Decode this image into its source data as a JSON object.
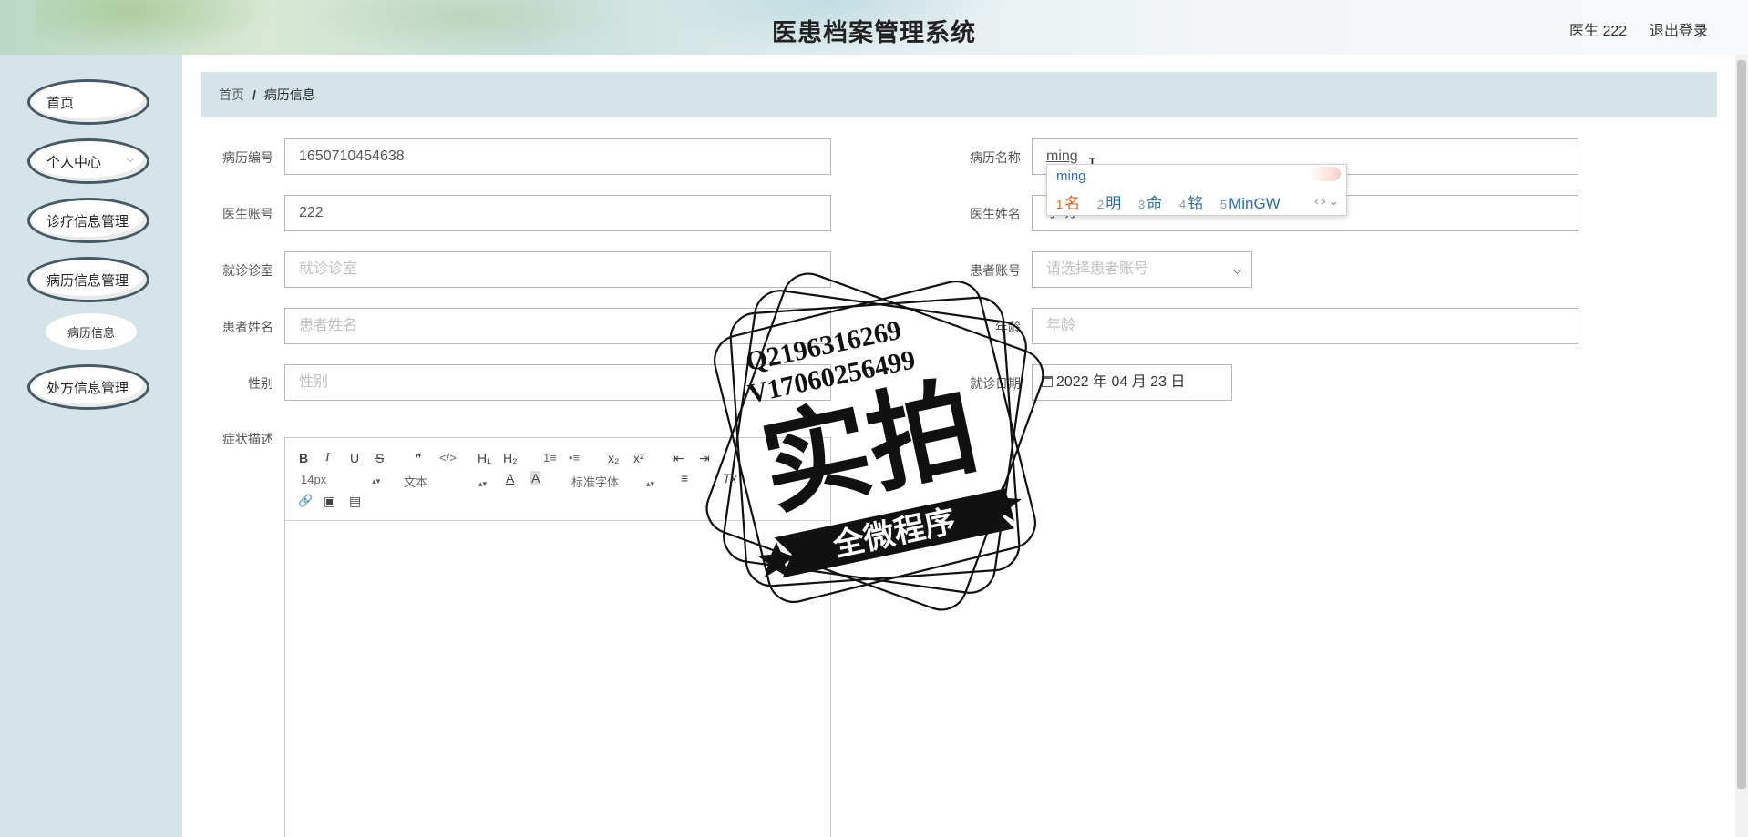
{
  "header": {
    "app_title": "医患档案管理系统",
    "user_label": "医生 222",
    "logout": "退出登录"
  },
  "sidebar": {
    "items": [
      {
        "label": "首页"
      },
      {
        "label": "个人中心",
        "chevron": "⌵"
      },
      {
        "label": "诊疗信息管理"
      },
      {
        "label": "病历信息管理"
      },
      {
        "label": "处方信息管理"
      }
    ],
    "sub_item": "病历信息"
  },
  "breadcrumb": {
    "home": "首页",
    "separator": "/",
    "current": "病历信息"
  },
  "form": {
    "record_no": {
      "label": "病历编号",
      "value": "1650710454638"
    },
    "doctor_account": {
      "label": "医生账号",
      "value": "222"
    },
    "clinic_room": {
      "label": "就诊诊室",
      "placeholder": "就诊诊室"
    },
    "patient_name": {
      "label": "患者姓名",
      "placeholder": "患者姓名"
    },
    "gender": {
      "label": "性别",
      "placeholder": "性别"
    },
    "symptom": {
      "label": "症状描述"
    },
    "record_name": {
      "label": "病历名称",
      "value": "ming"
    },
    "doctor_name": {
      "label": "医生姓名",
      "value": "小明"
    },
    "patient_account": {
      "label": "患者账号",
      "placeholder": "请选择患者账号"
    },
    "age": {
      "label": "年龄",
      "placeholder": "年龄"
    },
    "visit_date": {
      "label": "就诊日期",
      "value": "2022 年 04 月 23 日"
    }
  },
  "editor": {
    "font_size": "14px",
    "heading": "文本",
    "font_family": "标准字体",
    "buttons": {
      "bold": "B",
      "italic": "I",
      "underline": "U",
      "strike": "S",
      "quote": "❞",
      "code": "</>",
      "h1": "H₁",
      "h2": "H₂",
      "ordered": "1≡",
      "bullet": "•≡",
      "sub": "x₂",
      "sup": "x²",
      "outdent": "⇤",
      "indent": "⇥",
      "color": "A",
      "background": "A",
      "align": "≡",
      "clean": "Tx",
      "link": "🔗",
      "image": "▣",
      "video": "▤"
    }
  },
  "ime": {
    "composition": "ming",
    "candidates": [
      {
        "n": "1",
        "w": "名"
      },
      {
        "n": "2",
        "w": "明"
      },
      {
        "n": "3",
        "w": "命"
      },
      {
        "n": "4",
        "w": "铭"
      },
      {
        "n": "5",
        "w": "MinGW"
      }
    ],
    "nav": "‹ › ⌄"
  },
  "watermark": {
    "qq": "Q2196316269",
    "vx": "V17060256499",
    "main": "实拍",
    "ribbon": "全微程序"
  },
  "icons": {
    "calendar": "calendar-icon",
    "select_arrow": "chevron-down-icon",
    "text_cursor": "ibeam-cursor-icon"
  }
}
